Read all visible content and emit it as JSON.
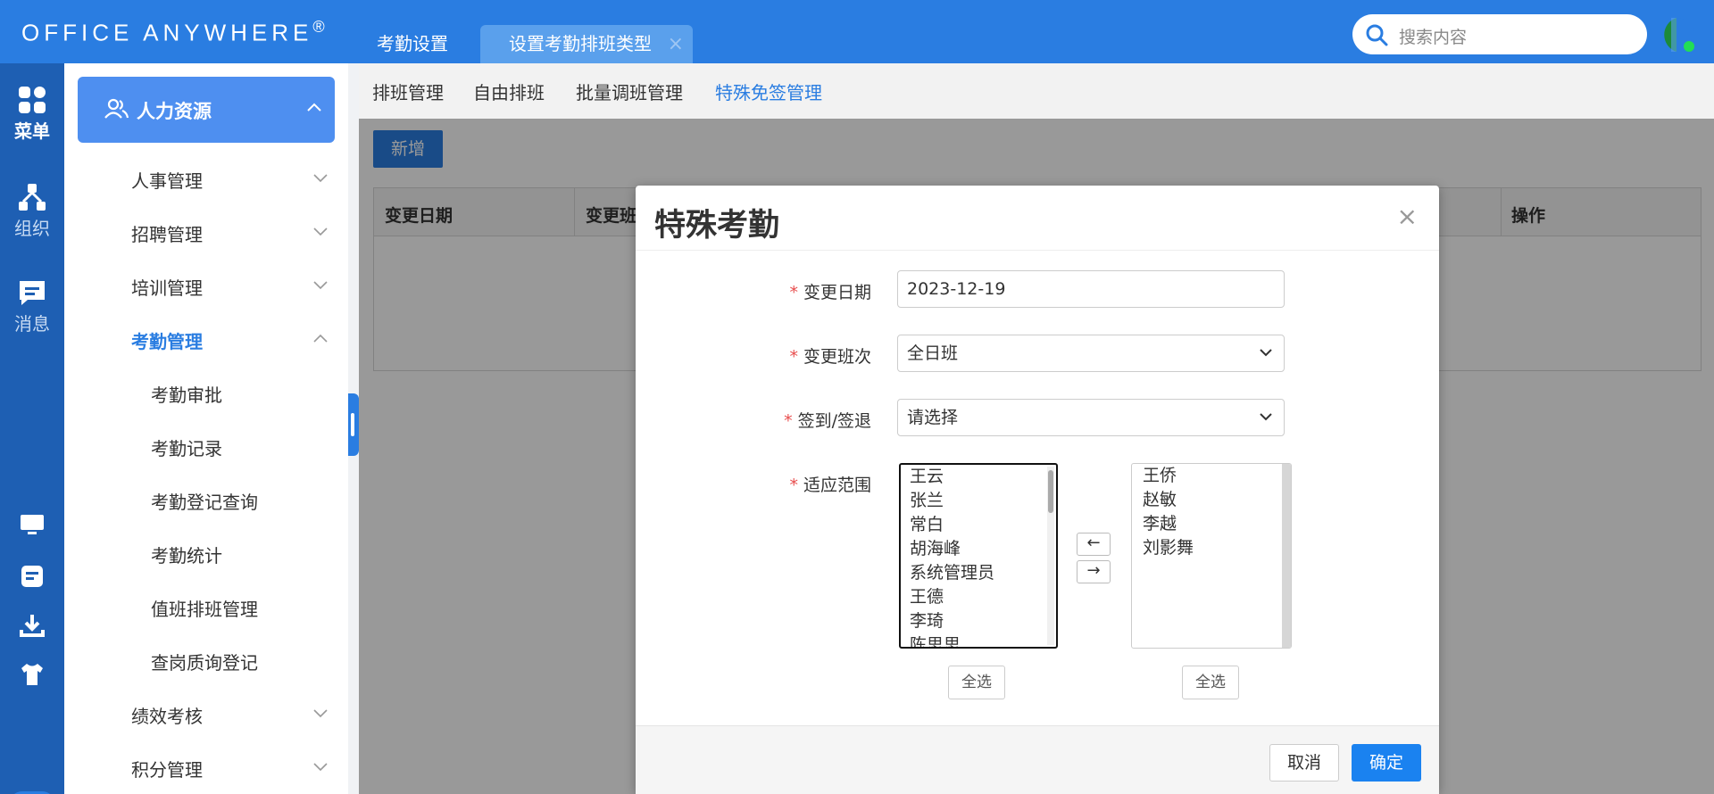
{
  "brand": {
    "logo_text": "Office Anywhere",
    "logo_mark": "®"
  },
  "top_tabs": [
    {
      "label": "考勤设置"
    },
    {
      "label": "设置考勤排班类型",
      "close": "×"
    }
  ],
  "search": {
    "placeholder": "搜索内容"
  },
  "rail": {
    "items": [
      {
        "label": "菜单",
        "icon": "grid-icon"
      },
      {
        "label": "组织",
        "icon": "org-icon"
      },
      {
        "label": "消息",
        "icon": "message-icon"
      }
    ],
    "bottom_icons": [
      "monitor-icon",
      "note-icon",
      "download-icon",
      "shirt-icon",
      "toggle-pill-icon"
    ]
  },
  "sidemenu": {
    "header": "人力资源",
    "items": [
      {
        "label": "人事管理"
      },
      {
        "label": "招聘管理"
      },
      {
        "label": "培训管理"
      },
      {
        "label": "考勤管理"
      },
      {
        "label": "考勤审批"
      },
      {
        "label": "考勤记录"
      },
      {
        "label": "考勤登记查询"
      },
      {
        "label": "考勤统计"
      },
      {
        "label": "值班排班管理"
      },
      {
        "label": "查岗质询登记"
      },
      {
        "label": "绩效考核"
      },
      {
        "label": "积分管理"
      }
    ]
  },
  "subnav": {
    "items": [
      {
        "label": "排班管理"
      },
      {
        "label": "自由排班"
      },
      {
        "label": "批量调班管理"
      },
      {
        "label": "特殊免签管理"
      }
    ]
  },
  "toolbar": {
    "add_label": "新增"
  },
  "table": {
    "columns": [
      "变更日期",
      "变更班",
      "操作"
    ]
  },
  "modal": {
    "title": "特殊考勤",
    "close": "×",
    "fields": {
      "date": {
        "label": "变更日期",
        "value": "2023-12-19"
      },
      "shift": {
        "label": "变更班次",
        "value": "全日班"
      },
      "signin": {
        "label": "签到/签退",
        "value": "请选择"
      },
      "scope": {
        "label": "适应范围"
      }
    },
    "left_list": [
      "王云",
      "张兰",
      "常白",
      "胡海峰",
      "系统管理员",
      "王德",
      "李琦",
      "陈思思"
    ],
    "right_list": [
      "王侨",
      "赵敏",
      "李越",
      "刘影舞"
    ],
    "move_left": "←",
    "move_right": "→",
    "select_all": "全选",
    "cancel_label": "取消",
    "ok_label": "确定",
    "required_mark": "*"
  },
  "colors": {
    "primary": "#2a7de1",
    "rail": "#1e5fb3",
    "active_text": "#2a7de1",
    "required": "#e84d4d"
  }
}
